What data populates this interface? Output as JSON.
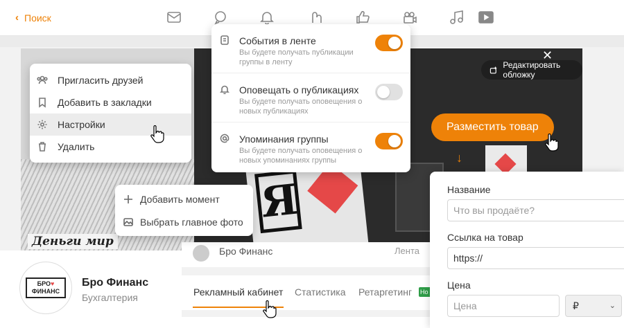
{
  "topbar": {
    "back_label": "Поиск",
    "icons": [
      "mail-icon",
      "chat-icon",
      "bell-icon",
      "guests-icon",
      "like-icon",
      "camera-icon",
      "music-icon",
      "video-icon"
    ]
  },
  "cover": {
    "edit_label": "Редактировать обложку",
    "place_product_label": "Разместить товар",
    "caption_text": "Деньги мир"
  },
  "left_menu": {
    "items": [
      {
        "label": "Пригласить друзей",
        "icon": "group-icon"
      },
      {
        "label": "Добавить в закладки",
        "icon": "bookmark-icon"
      },
      {
        "label": "Настройки",
        "icon": "settings-icon",
        "hovered": true
      },
      {
        "label": "Удалить",
        "icon": "trash-icon"
      }
    ]
  },
  "moment_menu": {
    "items": [
      {
        "label": "Добавить момент",
        "icon": "plus-icon"
      },
      {
        "label": "Выбрать главное фото",
        "icon": "image-icon"
      }
    ]
  },
  "notify_menu": {
    "items": [
      {
        "title": "События в ленте",
        "desc": "Вы будете получать публикации группы в ленту",
        "on": true,
        "icon": "feed-icon"
      },
      {
        "title": "Оповещать о публикациях",
        "desc": "Вы будете получать оповещения о новых публикациях",
        "on": false,
        "icon": "bell-icon"
      },
      {
        "title": "Упоминания группы",
        "desc": "Вы будете получать оповещения о новых упоминаниях группы",
        "on": true,
        "icon": "at-icon"
      }
    ]
  },
  "profile": {
    "name": "Бро Финанс",
    "category": "Бухгалтерия",
    "logo_line1": "БРО",
    "logo_line2": "ФИНАНС"
  },
  "feed": {
    "name": "Бро Финанс",
    "right": "Лента"
  },
  "tabs": {
    "items": [
      "Рекламный кабинет",
      "Статистика",
      "Ретаргетинг"
    ],
    "badge": "Но"
  },
  "product_form": {
    "name_label": "Название",
    "name_placeholder": "Что вы продаёте?",
    "link_label": "Ссылка на товар",
    "link_value": "https://",
    "price_label": "Цена",
    "price_placeholder": "Цена",
    "currency": "₽"
  },
  "colors": {
    "accent": "#ee8208",
    "toggle_off": "#e1e1e1",
    "badge_green": "#2f9d48"
  }
}
